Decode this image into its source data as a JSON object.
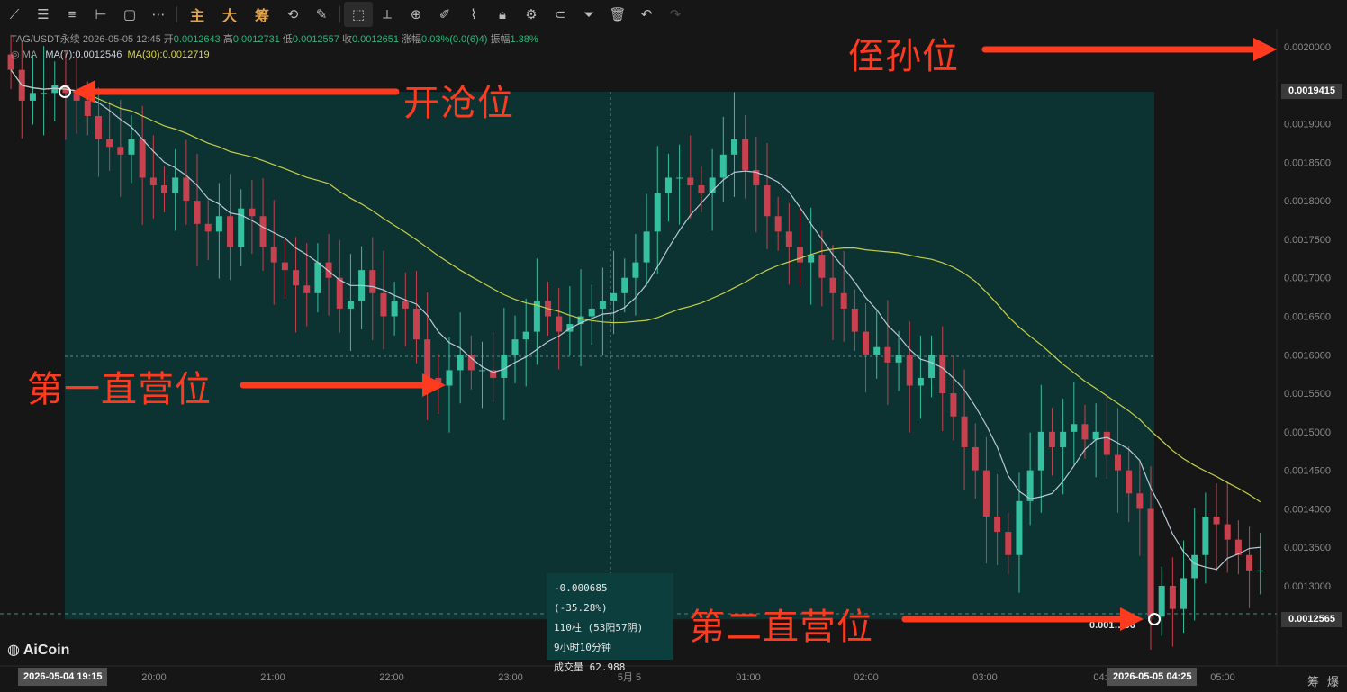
{
  "toolbar": {
    "text_buttons": [
      "主",
      "大",
      "筹"
    ]
  },
  "header": {
    "symbol": "TAG/USDT永续",
    "timestamp": "2026-05-05 12:45",
    "open_label": "开",
    "open": "0.0012643",
    "high_label": "高",
    "high": "0.0012731",
    "low_label": "低",
    "low": "0.0012557",
    "close_label": "收",
    "close": "0.0012651",
    "change_label": "涨幅",
    "change": "0.03%(0.0(6)4)",
    "amp_label": "振幅",
    "amp": "1.38%",
    "ma_label": "MA",
    "ma7": "MA(7):0.0012546",
    "ma30": "MA(30):0.0012719"
  },
  "logo": "AiCoin",
  "measure_tooltip": {
    "line1": "-0.000685 (-35.28%)",
    "line2": "110柱 (53阳57阴)",
    "line3": "9小时10分钟",
    "line4": "成交量 62.988"
  },
  "annotations": {
    "stop_loss": "侄孙位",
    "open_position": "开沧位",
    "first_tp": "第一直营位",
    "second_tp": "第二直营位"
  },
  "price_labels": {
    "top_box": "0.0019415",
    "bottom_box": "0.0012565",
    "end_marker": "0.001…66",
    "partial_top": "0.0012565"
  },
  "time_axis": {
    "start_box": "2026-05-04 19:15",
    "end_box": "2026-05-05 04:25",
    "corner_left": "筹",
    "corner_right": "爆"
  },
  "colors": {
    "up": "#35c1a0",
    "down": "#c8414f",
    "ma7": "#b9c9d6",
    "ma30": "#c7cf4a",
    "box": "#0c3232",
    "annotation": "#ff3b1f"
  },
  "chart_data": {
    "type": "candlestick",
    "pair": "TAG/USDT",
    "y_ticks": [
      "0.0020000",
      "0.0019000",
      "0.0018500",
      "0.0018000",
      "0.0017500",
      "0.0017000",
      "0.0016500",
      "0.0016000",
      "0.0015500",
      "0.0015000",
      "0.0014500",
      "0.0014000",
      "0.0013500",
      "0.0013000"
    ],
    "x_ticks": [
      "20:00",
      "21:00",
      "22:00",
      "23:00",
      "5月 5",
      "01:00",
      "02:00",
      "03:00",
      "04:",
      "05:00"
    ],
    "ylim": [
      0.00123,
      0.00205
    ],
    "measure_range": {
      "from_price": 0.0019415,
      "to_price": 0.0012565
    },
    "candles_close_approx": [
      0.00197,
      0.00193,
      0.00194,
      0.00194,
      0.00195,
      0.00194,
      0.00193,
      0.00191,
      0.00188,
      0.00187,
      0.00186,
      0.00188,
      0.00183,
      0.00182,
      0.00181,
      0.00183,
      0.0018,
      0.00177,
      0.00176,
      0.00178,
      0.00174,
      0.00179,
      0.00178,
      0.00174,
      0.00172,
      0.00171,
      0.00169,
      0.00168,
      0.00172,
      0.0017,
      0.00166,
      0.00167,
      0.00171,
      0.00168,
      0.00165,
      0.00167,
      0.00166,
      0.00162,
      0.00157,
      0.00156,
      0.00158,
      0.0016,
      0.00158,
      0.00158,
      0.00157,
      0.0016,
      0.00162,
      0.00163,
      0.00167,
      0.00165,
      0.00163,
      0.00164,
      0.00165,
      0.00166,
      0.00167,
      0.00168,
      0.0017,
      0.00172,
      0.00176,
      0.00181,
      0.00183,
      0.00183,
      0.00182,
      0.00181,
      0.00183,
      0.00186,
      0.00188,
      0.00184,
      0.00182,
      0.00178,
      0.00176,
      0.00174,
      0.00172,
      0.00173,
      0.0017,
      0.00168,
      0.00166,
      0.00163,
      0.0016,
      0.00161,
      0.00159,
      0.0016,
      0.00156,
      0.00157,
      0.0016,
      0.00155,
      0.00152,
      0.00148,
      0.00145,
      0.00139,
      0.00137,
      0.00134,
      0.00141,
      0.00145,
      0.0015,
      0.00148,
      0.0015,
      0.00151,
      0.00149,
      0.0015,
      0.00147,
      0.00145,
      0.00142,
      0.0014,
      0.00126,
      0.0013,
      0.00127,
      0.00131,
      0.00134,
      0.00139,
      0.00138,
      0.00136,
      0.00134,
      0.00132,
      0.00132
    ]
  }
}
